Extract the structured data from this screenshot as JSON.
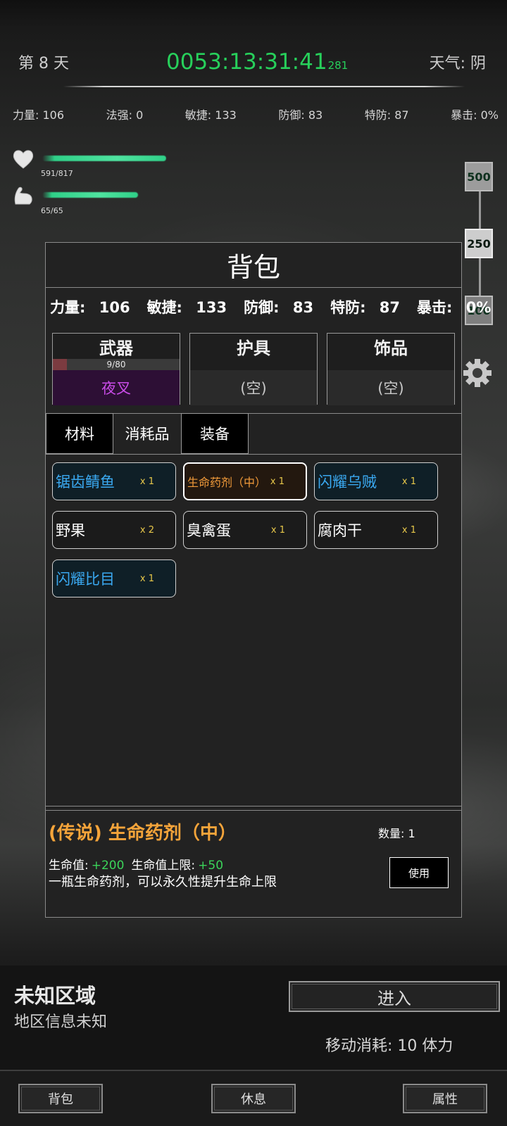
{
  "header": {
    "day": "第 8 天",
    "timer": "0053:13:31:41",
    "timer_ms": "281",
    "weather": "天气: 阴"
  },
  "stats": [
    {
      "label": "力量:",
      "value": "106"
    },
    {
      "label": "法强:",
      "value": "0"
    },
    {
      "label": "敏捷:",
      "value": "133"
    },
    {
      "label": "防御:",
      "value": "83"
    },
    {
      "label": "特防:",
      "value": "87"
    },
    {
      "label": "暴击:",
      "value": "0%"
    }
  ],
  "hp": {
    "text": "591/817",
    "current": 591,
    "max": 817
  },
  "stamina": {
    "text": "65/65",
    "current": 65,
    "max": 65
  },
  "zoom": {
    "levels": [
      "500",
      "250",
      "100"
    ],
    "selected": "250"
  },
  "icons": {
    "hp": "heart-icon",
    "stamina": "arm-icon",
    "settings": "gear-icon"
  },
  "backpack": {
    "title": "背包",
    "stats": [
      {
        "label": "力量:",
        "value": "106"
      },
      {
        "label": "敏捷:",
        "value": "133"
      },
      {
        "label": "防御:",
        "value": "83"
      },
      {
        "label": "特防:",
        "value": "87"
      },
      {
        "label": "暴击:",
        "value": "0%"
      }
    ],
    "slots": [
      {
        "title": "武器",
        "durability": "9/80",
        "durability_fraction": 0.1125,
        "value": "夜叉"
      },
      {
        "title": "护具",
        "value": "(空)"
      },
      {
        "title": "饰品",
        "value": "(空)"
      }
    ],
    "tabs": [
      "材料",
      "消耗品",
      "装备"
    ],
    "items": [
      {
        "name": "锯齿鲭鱼",
        "qty": "x 1",
        "style": "blue"
      },
      {
        "name": "生命药剂（中）",
        "qty": "x 1",
        "style": "selected"
      },
      {
        "name": "闪耀乌贼",
        "qty": "x 1",
        "style": "blue"
      },
      {
        "name": "野果",
        "qty": "x 2",
        "style": "normal"
      },
      {
        "name": "臭禽蛋",
        "qty": "x 1",
        "style": "normal"
      },
      {
        "name": "腐肉干",
        "qty": "x 1",
        "style": "normal"
      },
      {
        "name": "闪耀比目",
        "qty": "x 1",
        "style": "blue"
      }
    ],
    "detail": {
      "title": "(传说) 生命药剂（中）",
      "qty_label": "数量:",
      "qty_value": "1",
      "attr1_label": "生命值:",
      "attr1_value": "+200",
      "attr2_label": "生命值上限:",
      "attr2_value": "+50",
      "description": "一瓶生命药剂，可以永久性提升生命上限",
      "use_label": "使用"
    }
  },
  "region": {
    "name": "未知区域",
    "info": "地区信息未知",
    "enter_label": "进入",
    "move_cost": "移动消耗:  10 体力"
  },
  "nav": [
    "背包",
    "休息",
    "属性"
  ],
  "colors": {
    "timer": "#27d05b",
    "legendary": "#f5a43a",
    "rare_blue": "#3aa8f0",
    "epic_purple": "#c94ce8",
    "qty_yellow": "#e8c84a",
    "bonus_green": "#3bd45a"
  }
}
